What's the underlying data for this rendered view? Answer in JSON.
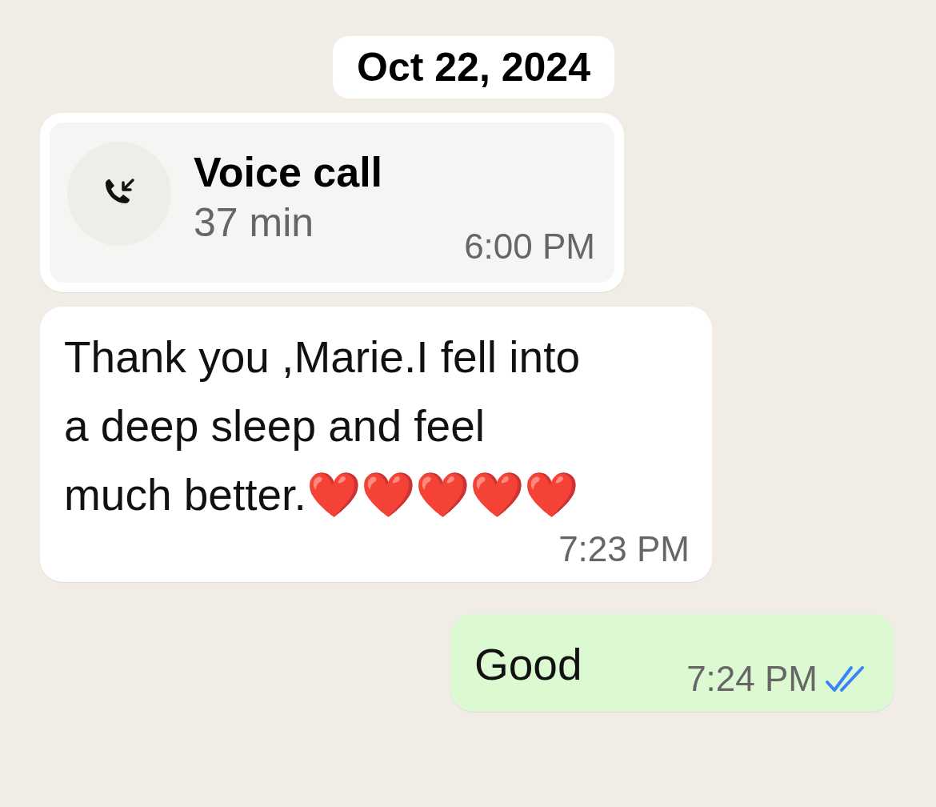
{
  "date_label": "Oct 22, 2024",
  "messages": [
    {
      "kind": "call",
      "outgoing": false,
      "title": "Voice call",
      "duration": "37 min",
      "time": "6:00 PM"
    },
    {
      "kind": "text",
      "outgoing": false,
      "text": "Thank you ,Marie.I fell into a deep sleep and feel much better.❤️❤️❤️❤️❤️",
      "time": "7:23 PM"
    },
    {
      "kind": "text",
      "outgoing": true,
      "text": "Good",
      "time": "7:24 PM",
      "read": true
    }
  ]
}
